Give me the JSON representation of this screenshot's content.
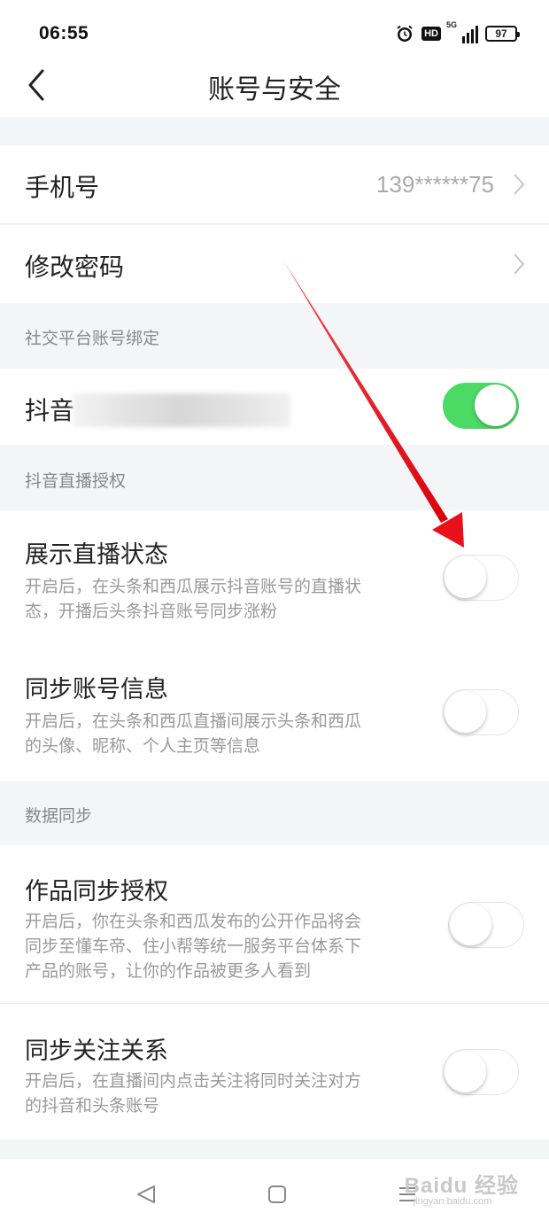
{
  "status_bar": {
    "time": "06:55",
    "hd": "HD",
    "network": "5G",
    "battery": "97"
  },
  "header": {
    "title": "账号与安全"
  },
  "account": {
    "phone_label": "手机号",
    "phone_value": "139******75",
    "password_label": "修改密码"
  },
  "social": {
    "header": "社交平台账号绑定",
    "douyin_label": "抖音",
    "douyin_enabled": true
  },
  "live_auth": {
    "header": "抖音直播授权",
    "items": [
      {
        "title": "展示直播状态",
        "desc_line1": "开启后，在头条和西瓜展示抖音账号的直播状",
        "desc_line2": "态，开播后头条抖音账号同步涨粉",
        "enabled": false
      },
      {
        "title": "同步账号信息",
        "desc_line1": "开启后，在头条和西瓜直播间展示头条和西瓜",
        "desc_line2": "的头像、昵称、个人主页等信息",
        "enabled": false
      }
    ]
  },
  "data_sync": {
    "header": "数据同步",
    "items": [
      {
        "title": "作品同步授权",
        "desc_line1": "开启后，你在头条和西瓜发布的公开作品将会",
        "desc_line2": "同步至懂车帝、住小帮等统一服务平台体系下",
        "desc_line3": "产品的账号，让你的作品被更多人看到",
        "enabled": false
      },
      {
        "title": "同步关注关系",
        "desc_line1": "开启后，在直播间内点击关注将同时关注对方",
        "desc_line2": "的抖音和头条账号",
        "enabled": false
      }
    ]
  },
  "watermark": {
    "main": "Baidu 经验",
    "sub": "jingyan.baidu.com"
  },
  "colors": {
    "toggle_on": "#4cd964",
    "annotation_arrow": "#e8101a",
    "background": "#f4f5f7"
  }
}
